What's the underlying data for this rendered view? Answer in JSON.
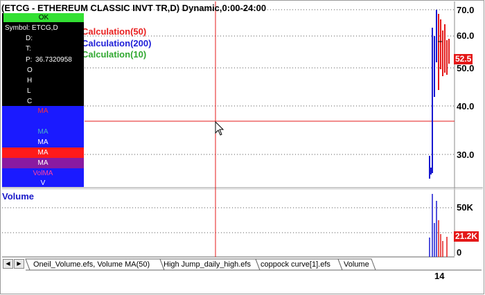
{
  "chart": {
    "title": "(ETCG - ETHEREUM CLASSIC INVT TR,D) Dynamic,0:00-24:00",
    "calc_labels": [
      {
        "text": "Calculation(50)",
        "color": "#e82020"
      },
      {
        "text": "Calculation(200)",
        "color": "#2020d8"
      },
      {
        "text": "Calculation(10)",
        "color": "#30a830"
      }
    ],
    "price_axis_ticks": [
      "70.0",
      "60.0",
      "50.0",
      "40.0",
      "30.0"
    ],
    "last_price": "52.5",
    "volume_label": "Volume",
    "volume_axis_ticks": [
      "50K",
      "0"
    ],
    "last_volume": "21.2K",
    "date_tick": "14"
  },
  "cursor_window": {
    "ok_label": "OK",
    "symbol": "Symbol: ETCG,D",
    "fields": [
      {
        "label": "D:",
        "value": ""
      },
      {
        "label": "T:",
        "value": ""
      },
      {
        "label": "P:",
        "value": "36.7320958"
      },
      {
        "label": "O",
        "value": ""
      },
      {
        "label": "H",
        "value": ""
      },
      {
        "label": "L",
        "value": ""
      },
      {
        "label": "C",
        "value": ""
      }
    ],
    "studies": [
      {
        "label": "MA",
        "bg": "#1a1aff",
        "fg": "#ff3030"
      },
      {
        "label": "MA",
        "bg": "#1a1aff",
        "fg": "#4ab0c8"
      },
      {
        "label": "MA",
        "bg": "#1a1aff",
        "fg": "#ffffff"
      },
      {
        "label": "MA",
        "bg": "#ff1a1a",
        "fg": "#ffffff"
      },
      {
        "label": "MA",
        "bg": "#8a1aa0",
        "fg": "#ffffff"
      },
      {
        "label": "VolMA",
        "bg": "#1a1aff",
        "fg": "#ff40a0"
      },
      {
        "label": "V",
        "bg": "#1a1aff",
        "fg": "#ffffff"
      }
    ]
  },
  "tabs": [
    {
      "label": "Oneil_Volume.efs, Volume MA(50)",
      "active": false
    },
    {
      "label": "High Jump_daily_high.efs",
      "active": false
    },
    {
      "label": "coppock curve[1].efs",
      "active": false
    },
    {
      "label": "Volume",
      "active": true
    }
  ],
  "nav": {
    "prev_icon": "◀",
    "next_icon": "▶"
  },
  "colors": {
    "crosshair": "#e41818",
    "grid": "#555555",
    "up_bar": "#1818d0",
    "down_bar": "#e41818"
  }
}
